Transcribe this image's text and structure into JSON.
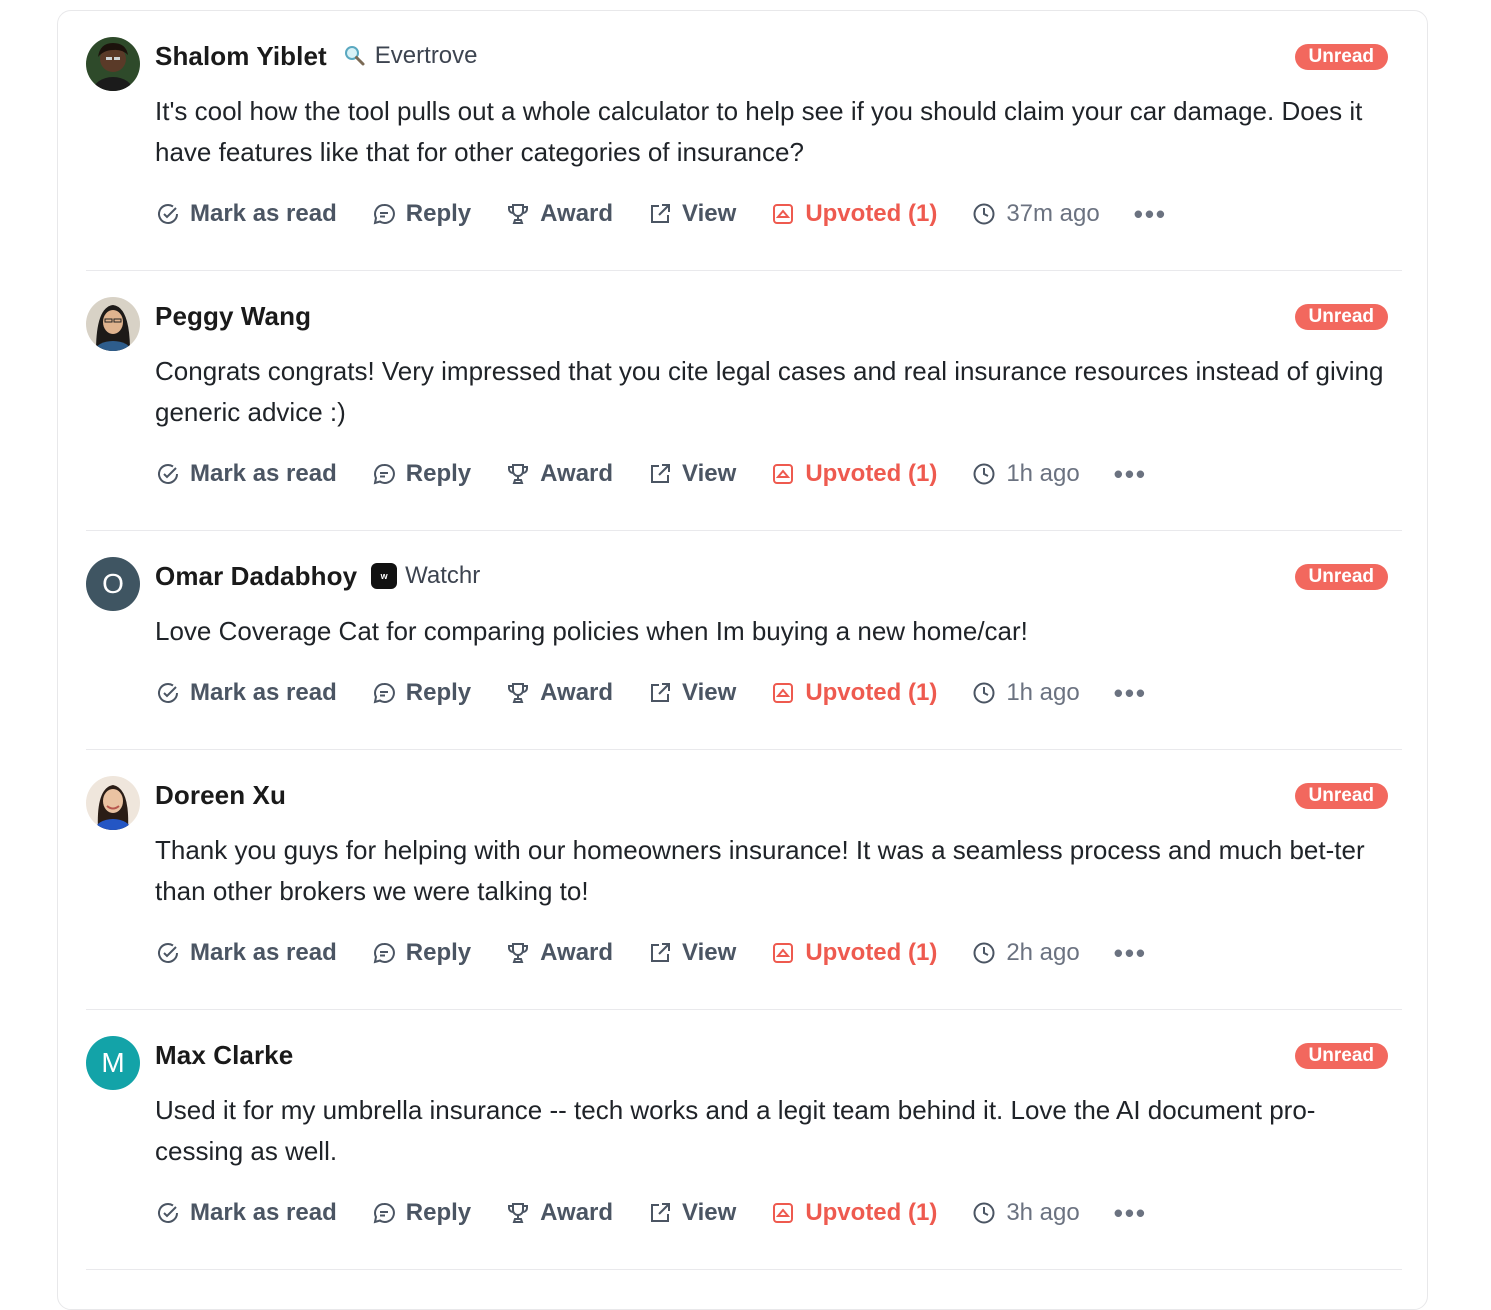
{
  "labels": {
    "mark_read": "Mark as read",
    "reply": "Reply",
    "award": "Award",
    "view": "View",
    "upvoted": "Upvoted (1)",
    "unread": "Unread",
    "more": "•••"
  },
  "colors": {
    "unread_badge": "#f2685e",
    "upvote": "#ee5a4f",
    "avatar_o": "#3f5562",
    "avatar_m": "#13a3a8"
  },
  "comments": [
    {
      "name": "Shalom Yiblet",
      "company": "Evertrove",
      "company_icon": "magnifier-icon",
      "text": "It's cool how the tool pulls out a whole calculator to help see if you should claim your car damage. Does it have features like that for other categories of insurance?",
      "time": "37m ago",
      "avatar": "photo"
    },
    {
      "name": "Peggy Wang",
      "company": "",
      "text": "Congrats congrats! Very impressed that you cite legal cases and real insurance resources instead of giving generic advice :)",
      "time": "1h ago",
      "avatar": "photo"
    },
    {
      "name": "Omar Dadabhoy",
      "company": "Watchr",
      "company_icon": "watchr-logo-icon",
      "text": "Love Coverage Cat for comparing policies when Im buying a new home/car!",
      "time": "1h ago",
      "avatar_letter": "O"
    },
    {
      "name": "Doreen Xu",
      "company": "",
      "text": "Thank you guys for helping with our homeowners insurance! It was a seamless process and much bet-ter than other brokers we were talking to!",
      "time": "2h ago",
      "avatar": "photo"
    },
    {
      "name": "Max Clarke",
      "company": "",
      "text": "Used it for my umbrella insurance -- tech works and a legit team behind it. Love the AI document pro-cessing as well.",
      "time": "3h ago",
      "avatar_letter": "M"
    }
  ]
}
